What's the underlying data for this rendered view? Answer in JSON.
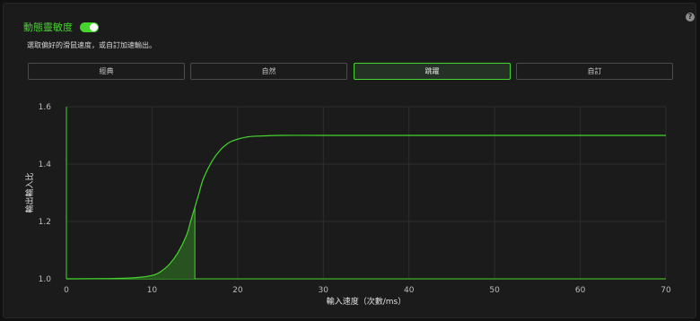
{
  "header": {
    "title": "動態靈敏度",
    "toggle_on": true,
    "help_glyph": "?",
    "description": "選取偏好的滑鼠速度，或自訂加速輸出。"
  },
  "modes": [
    {
      "label": "經典",
      "active": false
    },
    {
      "label": "自然",
      "active": false
    },
    {
      "label": "跳躍",
      "active": true
    },
    {
      "label": "自訂",
      "active": false
    }
  ],
  "colors": {
    "accent": "#44d62c",
    "panel": "#1b1b1b",
    "grid": "#2e2e2e"
  },
  "chart_data": {
    "type": "line",
    "xlabel": "輸入速度（次數/ms）",
    "ylabel": "輸出輸入比",
    "x_ticks": [
      0,
      10,
      20,
      30,
      40,
      50,
      60,
      70
    ],
    "y_ticks": [
      "1.0",
      "1.2",
      "1.4",
      "1.6"
    ],
    "xlim": [
      0,
      70
    ],
    "ylim": [
      1.0,
      1.6
    ],
    "grid": true,
    "series": [
      {
        "x": [
          0,
          5,
          8,
          10,
          11,
          12,
          13,
          14,
          14.5,
          15,
          15.5,
          16,
          17,
          18,
          19,
          20,
          21,
          22,
          25,
          30,
          40,
          50,
          60,
          70
        ],
        "y": [
          1.0,
          1.001,
          1.004,
          1.012,
          1.025,
          1.05,
          1.09,
          1.15,
          1.2,
          1.25,
          1.3,
          1.35,
          1.41,
          1.45,
          1.475,
          1.487,
          1.494,
          1.497,
          1.5,
          1.5,
          1.5,
          1.5,
          1.5,
          1.5
        ]
      }
    ],
    "shaded_marker_x": 15
  }
}
